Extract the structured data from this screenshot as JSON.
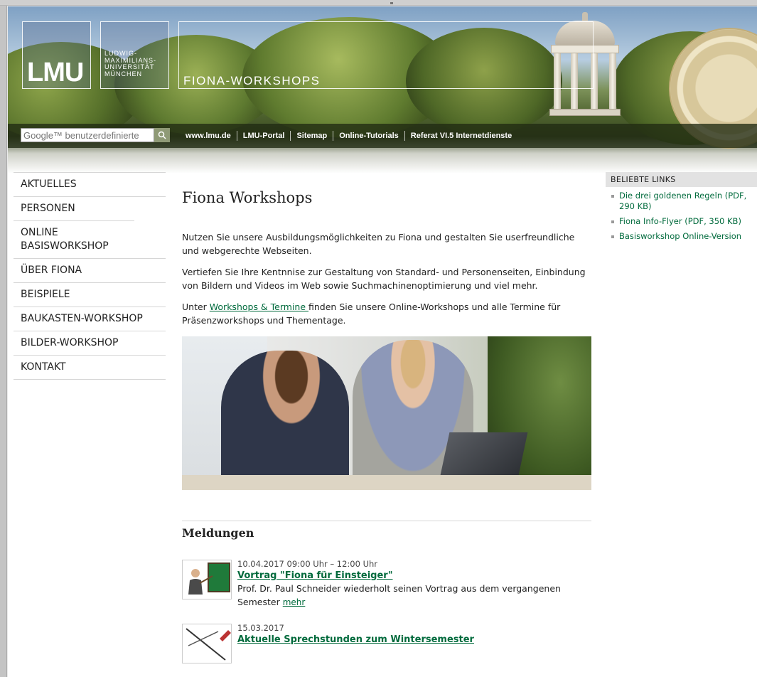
{
  "header": {
    "logo_text": "LMU",
    "university_lines": [
      "LUDWIG-",
      "MAXIMILIANS-",
      "UNIVERSITÄT",
      "MÜNCHEN"
    ],
    "site_title": "FIONA-WORKSHOPS",
    "search_placeholder": "Google™ benutzerdefinierte",
    "nav_links": [
      "www.lmu.de",
      "LMU-Portal",
      "Sitemap",
      "Online-Tutorials",
      "Referat VI.5 Internetdienste"
    ]
  },
  "sidebar": {
    "items": [
      "AKTUELLES",
      "PERSONEN",
      "ONLINE BASISWORKSHOP",
      "ÜBER FIONA",
      "BEISPIELE",
      "BAUKASTEN-WORKSHOP",
      "BILDER-WORKSHOP",
      "KONTAKT"
    ]
  },
  "main": {
    "title": "Fiona Workshops",
    "para1": "Nutzen Sie unsere Ausbildungsmöglichkeiten zu Fiona und gestalten Sie userfreundliche und webgerechte Webseiten.",
    "para2": "Vertiefen Sie Ihre Kentnnise zur Gestaltung von Standard- und Personenseiten, Einbindung von Bildern und Videos im Web sowie Suchmachinenoptimierung und viel mehr.",
    "para3_before": "Unter ",
    "para3_link": "Workshops & Termine ",
    "para3_after": "finden Sie unsere Online-Workshops und alle Termine für Präsenzworkshops und Thementage."
  },
  "news": {
    "section_title": "Meldungen",
    "items": [
      {
        "date": "10.04.2017 09:00 Uhr – 12:00 Uhr",
        "headline": "Vortrag \"Fiona für Einsteiger\"",
        "description": "Prof. Dr. Paul Schneider wiederholt seinen Vortrag aus dem vergangenen Semester ",
        "more": "mehr"
      },
      {
        "date": "15.03.2017",
        "headline": "Aktuelle Sprechstunden zum Wintersemester"
      }
    ]
  },
  "right": {
    "heading": "BELIEBTE LINKS",
    "links": [
      "Die drei goldenen Regeln (PDF, 290 KB)",
      "Fiona Info-Flyer (PDF, 350 KB)",
      "Basisworkshop Online-Version"
    ]
  },
  "colors": {
    "link_green": "#006a3c",
    "navbar": "#202a12"
  }
}
